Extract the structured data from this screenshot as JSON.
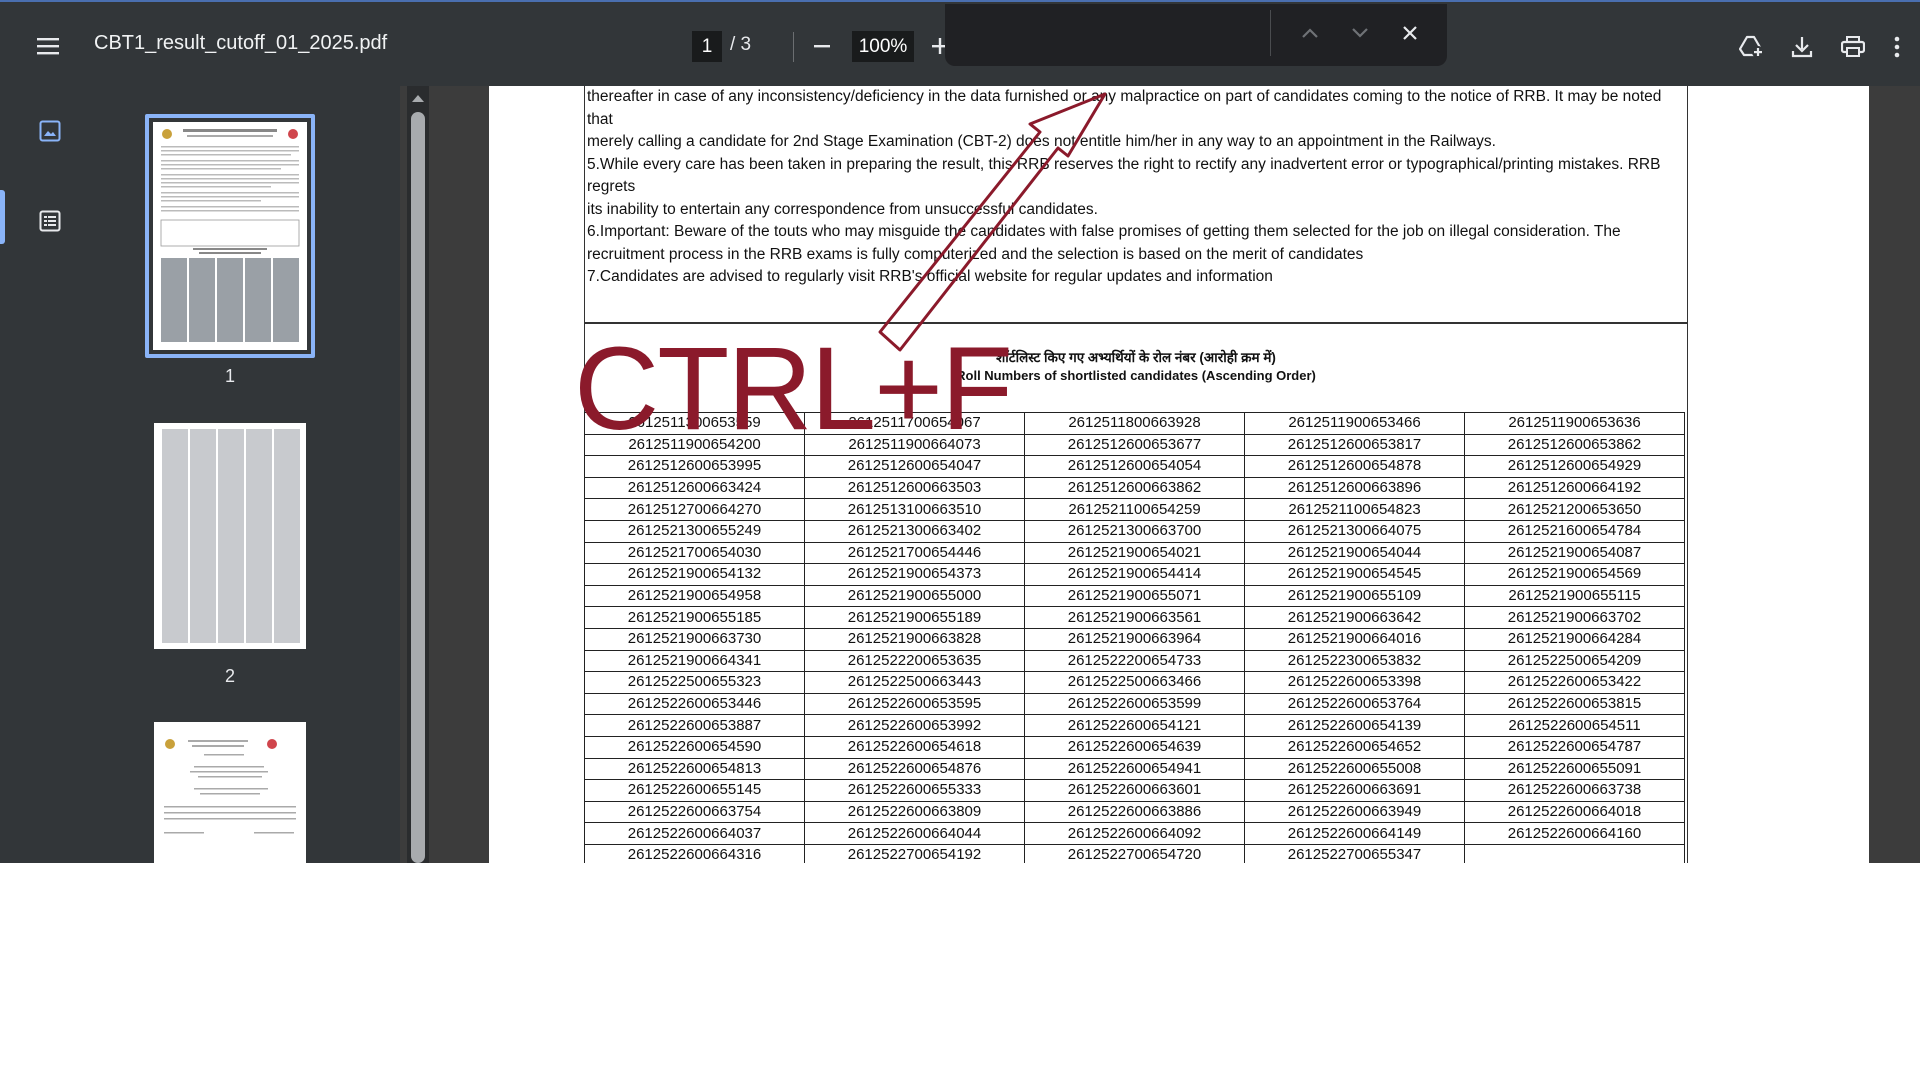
{
  "toolbar": {
    "menu_icon": "hamburger-menu-icon",
    "title": "CBT1_result_cutoff_01_2025.pdf",
    "current_page": "1",
    "page_total": "/ 3",
    "zoom_out_icon": "minus-icon",
    "zoom": "100%",
    "zoom_in_icon": "plus-icon",
    "drive_icon": "drive-add-icon",
    "download_icon": "download-icon",
    "print_icon": "print-icon",
    "more_icon": "more-vertical-icon"
  },
  "find_bar": {
    "value": "",
    "prev_icon": "chevron-up-icon",
    "next_icon": "chevron-down-icon",
    "close_icon": "close-icon"
  },
  "sidebar": {
    "thumbnails_icon": "thumbnails-icon",
    "outline_icon": "outline-icon",
    "pages": [
      {
        "label": "1"
      },
      {
        "label": "2"
      },
      {
        "label": ""
      }
    ]
  },
  "document": {
    "notes": [
      "thereafter in case of any inconsistency/deficiency in the data furnished or any malpractice on part of candidates coming to the notice of RRB. It may be noted that",
      "merely calling a candidate for 2nd Stage Examination (CBT-2) does not entitle him/her in any way to an appointment in the Railways.",
      "5.While every care has been taken in preparing the result, this RRB reserves the right to rectify any inadvertent error or typographical/printing mistakes. RRB regrets",
      "its inability to entertain any correspondence from unsuccessful candidates.",
      "6.Important: Beware of the touts who may misguide the candidates with false promises of getting them selected for the job on illegal consideration. The",
      "recruitment process in the RRB exams is fully computerized and the selection is based on the merit of candidates",
      "7.Candidates are advised to regularly visit RRB's official website for regular updates and information"
    ],
    "heading_hindi": "शॉर्टलिस्ट किए गए अभ्यर्थियों के रोल नंबर (आरोही क्रम में)",
    "heading_english": "Roll Numbers of shortlisted candidates (Ascending Order)",
    "rows": [
      [
        "2612511300653559",
        "2612511700654067",
        "2612511800663928",
        "2612511900653466",
        "2612511900653636"
      ],
      [
        "2612511900654200",
        "2612511900664073",
        "2612512600653677",
        "2612512600653817",
        "2612512600653862"
      ],
      [
        "2612512600653995",
        "2612512600654047",
        "2612512600654054",
        "2612512600654878",
        "2612512600654929"
      ],
      [
        "2612512600663424",
        "2612512600663503",
        "2612512600663862",
        "2612512600663896",
        "2612512600664192"
      ],
      [
        "2612512700664270",
        "2612513100663510",
        "2612521100654259",
        "2612521100654823",
        "2612521200653650"
      ],
      [
        "2612521300655249",
        "2612521300663402",
        "2612521300663700",
        "2612521300664075",
        "2612521600654784"
      ],
      [
        "2612521700654030",
        "2612521700654446",
        "2612521900654021",
        "2612521900654044",
        "2612521900654087"
      ],
      [
        "2612521900654132",
        "2612521900654373",
        "2612521900654414",
        "2612521900654545",
        "2612521900654569"
      ],
      [
        "2612521900654958",
        "2612521900655000",
        "2612521900655071",
        "2612521900655109",
        "2612521900655115"
      ],
      [
        "2612521900655185",
        "2612521900655189",
        "2612521900663561",
        "2612521900663642",
        "2612521900663702"
      ],
      [
        "2612521900663730",
        "2612521900663828",
        "2612521900663964",
        "2612521900664016",
        "2612521900664284"
      ],
      [
        "2612521900664341",
        "2612522200653635",
        "2612522200654733",
        "2612522300653832",
        "2612522500654209"
      ],
      [
        "2612522500655323",
        "2612522500663443",
        "2612522500663466",
        "2612522600653398",
        "2612522600653422"
      ],
      [
        "2612522600653446",
        "2612522600653595",
        "2612522600653599",
        "2612522600653764",
        "2612522600653815"
      ],
      [
        "2612522600653887",
        "2612522600653992",
        "2612522600654121",
        "2612522600654139",
        "2612522600654511"
      ],
      [
        "2612522600654590",
        "2612522600654618",
        "2612522600654639",
        "2612522600654652",
        "2612522600654787"
      ],
      [
        "2612522600654813",
        "2612522600654876",
        "2612522600654941",
        "2612522600655008",
        "2612522600655091"
      ],
      [
        "2612522600655145",
        "2612522600655333",
        "2612522600663601",
        "2612522600663691",
        "2612522600663738"
      ],
      [
        "2612522600663754",
        "2612522600663809",
        "2612522600663886",
        "2612522600663949",
        "2612522600664018"
      ],
      [
        "2612522600664037",
        "2612522600664044",
        "2612522600664092",
        "2612522600664149",
        "2612522600664160"
      ],
      [
        "2612522600664316",
        "2612522700654192",
        "2612522700654720",
        "2612522700655347",
        ""
      ]
    ]
  },
  "annotation": {
    "text": "CTRL+F",
    "color": "#8b1a2b"
  }
}
